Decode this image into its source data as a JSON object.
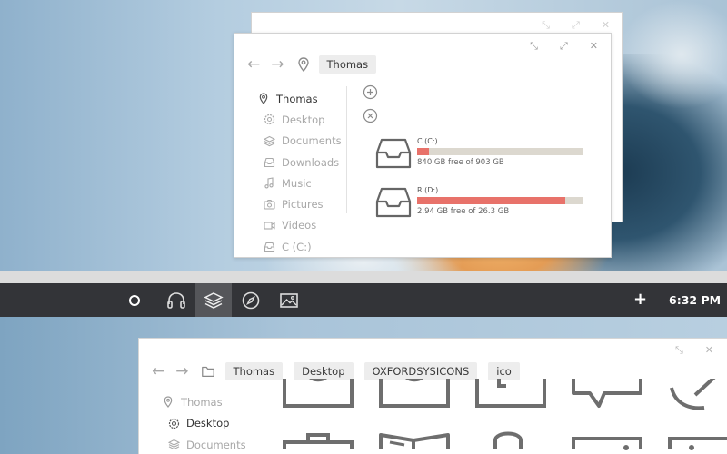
{
  "top_window": {
    "controls": [
      "⤡",
      "⤢",
      "✕"
    ],
    "back_controls": [
      "⤡",
      "⤢",
      "✕"
    ],
    "breadcrumb": [
      "Thomas"
    ],
    "sidebar": [
      {
        "label": "Thomas",
        "icon": "location-pin-icon",
        "active": true
      },
      {
        "label": "Desktop",
        "icon": "desktop-gear-icon"
      },
      {
        "label": "Documents",
        "icon": "layers-icon"
      },
      {
        "label": "Downloads",
        "icon": "inbox-tray-icon"
      },
      {
        "label": "Music",
        "icon": "music-note-icon"
      },
      {
        "label": "Pictures",
        "icon": "camera-icon"
      },
      {
        "label": "Videos",
        "icon": "video-camera-icon"
      },
      {
        "label": "C (C:)",
        "icon": "drive-icon"
      }
    ],
    "actions": [
      "add-circle-icon",
      "remove-circle-icon"
    ],
    "drives": [
      {
        "name": "C (C:)",
        "free_text": "840 GB free of 903 GB",
        "used_fraction": 0.07
      },
      {
        "name": "R (D:)",
        "free_text": "2.94 GB free of 26.3 GB",
        "used_fraction": 0.89
      }
    ],
    "colors": {
      "usage_fill": "#e8726a",
      "usage_track": "#dcd8cf"
    }
  },
  "taskbar": {
    "icons": [
      "circle-icon",
      "headphones-icon",
      "layers-icon",
      "compass-icon",
      "image-icon"
    ],
    "active_index": 2,
    "plus": "+",
    "clock": "6:32 PM",
    "background": "#333438"
  },
  "lower_window": {
    "controls": [
      "⤡",
      "✕"
    ],
    "breadcrumb": [
      "Thomas",
      "Desktop",
      "OXFORDSYSICONS",
      "ico"
    ],
    "sidebar": [
      {
        "label": "Thomas",
        "icon": "location-pin-icon"
      },
      {
        "label": "Desktop",
        "icon": "desktop-gear-icon",
        "active": true
      },
      {
        "label": "Documents",
        "icon": "layers-icon"
      }
    ]
  }
}
